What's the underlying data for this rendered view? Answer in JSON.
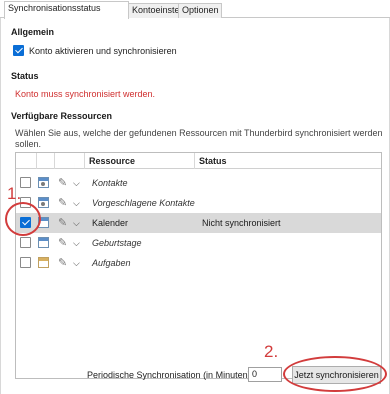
{
  "tabs": [
    {
      "label": "Synchronisationsstatus",
      "active": true
    },
    {
      "label": "Kontoeinstellungen",
      "active": false
    },
    {
      "label": "Optionen",
      "active": false
    }
  ],
  "general": {
    "heading": "Allgemein",
    "account_checkbox_label": "Konto aktivieren und synchronisieren",
    "account_checked": true
  },
  "status": {
    "heading": "Status",
    "message": "Konto muss synchronisiert werden."
  },
  "resources": {
    "heading": "Verfügbare Ressourcen",
    "description_line1": "Wählen Sie aus, welche der gefundenen Ressourcen mit Thunderbird synchronisiert werden",
    "description_line2": "sollen.",
    "columns": {
      "resource": "Ressource",
      "status": "Status"
    },
    "rows": [
      {
        "name": "Kontakte",
        "status": "",
        "checked": false,
        "icon": "address-book-icon",
        "italic": true
      },
      {
        "name": "Vorgeschlagene Kontakte",
        "status": "",
        "checked": false,
        "icon": "address-book-icon",
        "italic": true
      },
      {
        "name": "Kalender",
        "status": "Nicht synchronisiert",
        "checked": true,
        "icon": "calendar-icon",
        "italic": false,
        "selected": true
      },
      {
        "name": "Geburtstage",
        "status": "",
        "checked": false,
        "icon": "calendar-icon",
        "italic": true
      },
      {
        "name": "Aufgaben",
        "status": "",
        "checked": false,
        "icon": "task-list-icon",
        "italic": true
      }
    ]
  },
  "sync": {
    "label": "Periodische Synchronisation (in Minuten)",
    "value": "0",
    "button": "Jetzt synchronisieren"
  },
  "annotations": {
    "step1": "1.",
    "step2": "2.",
    "color": "#d23c3c"
  }
}
